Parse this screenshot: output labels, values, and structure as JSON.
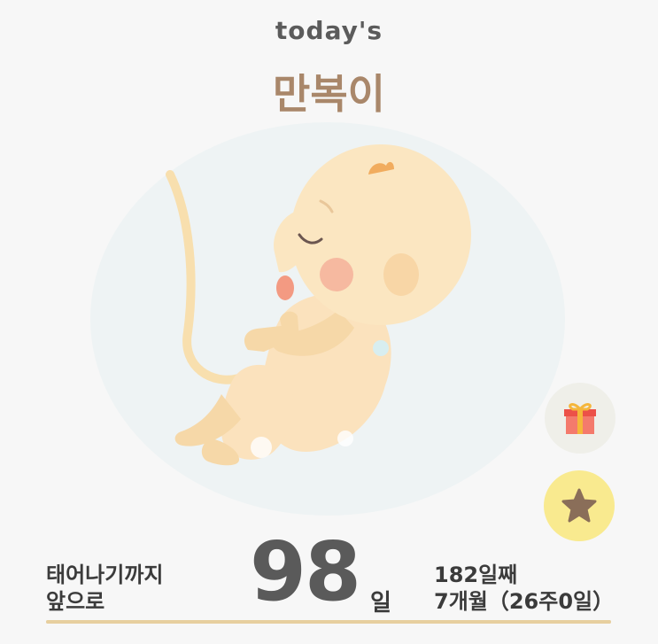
{
  "header": {
    "subtitle": "today's",
    "baby_nickname": "만복이"
  },
  "illustration": {
    "icon": "fetus-illustration"
  },
  "actions": {
    "gift_icon": "gift-icon",
    "star_icon": "star-icon"
  },
  "stats": {
    "countdown_label_line1": "태어나기까지",
    "countdown_label_line2": "앞으로",
    "days_remaining": "98",
    "days_unit": "일",
    "days_elapsed": "182일째",
    "months_weeks": "7개월（26주0일）"
  },
  "progress": {
    "fraction": 1.0
  },
  "colors": {
    "accent": "#a9876a",
    "gift_bg": "#efefe9",
    "star_bg": "#f9ea8f",
    "star": "#8a6e59",
    "progress": "#e7cf9f"
  }
}
